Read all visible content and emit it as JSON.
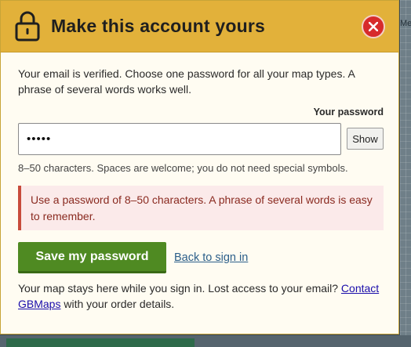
{
  "background": {
    "map_label": "Mes"
  },
  "dialog": {
    "title": "Make this account yours",
    "close_icon": "close-icon",
    "lock_icon": "lock-icon",
    "intro": "Your email is verified. Choose one password for all your map types. A phrase of several words works well.",
    "password_label": "Your password",
    "password_value": "•••••",
    "show_label": "Show",
    "hint": "8–50 characters. Spaces are welcome; you do not need special symbols.",
    "error": "Use a password of 8–50 characters. A phrase of several words is easy to remember.",
    "save_label": "Save my password",
    "back_label": "Back to sign in",
    "footer_before": "Your map stays here while you sign in. Lost access to your email? ",
    "footer_link": "Contact GBMaps",
    "footer_after": " with your order details."
  },
  "colors": {
    "header": "#e2b13a",
    "close": "#d72b2b",
    "save": "#4f8a22",
    "error_border": "#c84b3b",
    "error_bg": "#fbeaea",
    "error_text": "#8a2a20"
  }
}
